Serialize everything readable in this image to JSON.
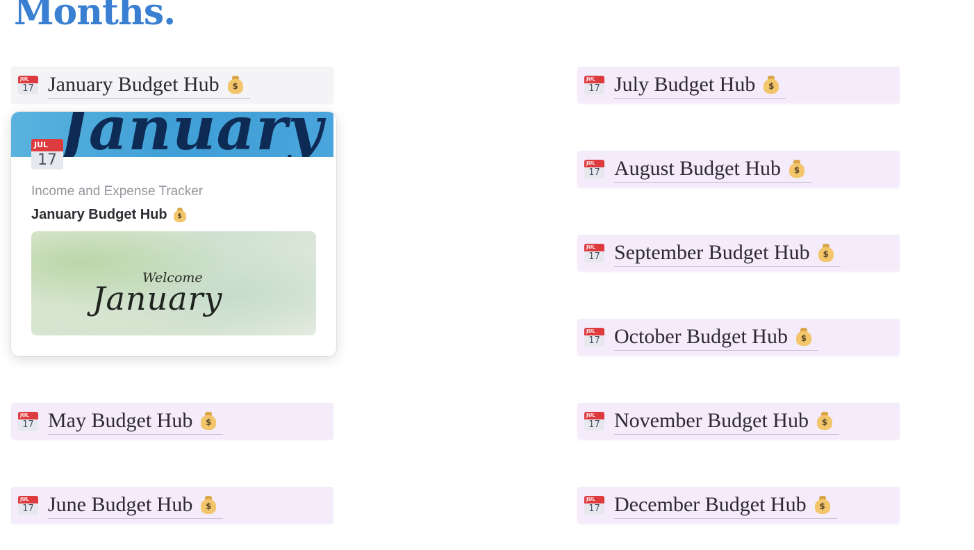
{
  "page": {
    "heading": "Months."
  },
  "colors": {
    "heading": "#3a7fd1",
    "hub_background_active": "#f4f3f6",
    "hub_background": "#f4ebfb",
    "cover_blue": "#4aa5dc"
  },
  "icons": {
    "calendar": "calendar-icon",
    "money_bag": "money-bag-icon"
  },
  "calendar_icon": {
    "month": "JUL",
    "day": "17"
  },
  "money_bag_symbol": "$",
  "hubs_left": [
    {
      "label": "January Budget Hub"
    },
    {
      "label": "May Budget Hub"
    },
    {
      "label": "June Budget Hub"
    }
  ],
  "hubs_right": [
    {
      "label": "July Budget Hub"
    },
    {
      "label": "August Budget Hub"
    },
    {
      "label": "September Budget Hub"
    },
    {
      "label": "October Budget Hub"
    },
    {
      "label": "November Budget Hub"
    },
    {
      "label": "December Budget Hub"
    }
  ],
  "preview": {
    "cover_text": "January",
    "subtitle": "Income and Expense Tracker",
    "title": "January Budget Hub",
    "image_welcome_text": "Welcome",
    "image_month_text": "January"
  }
}
